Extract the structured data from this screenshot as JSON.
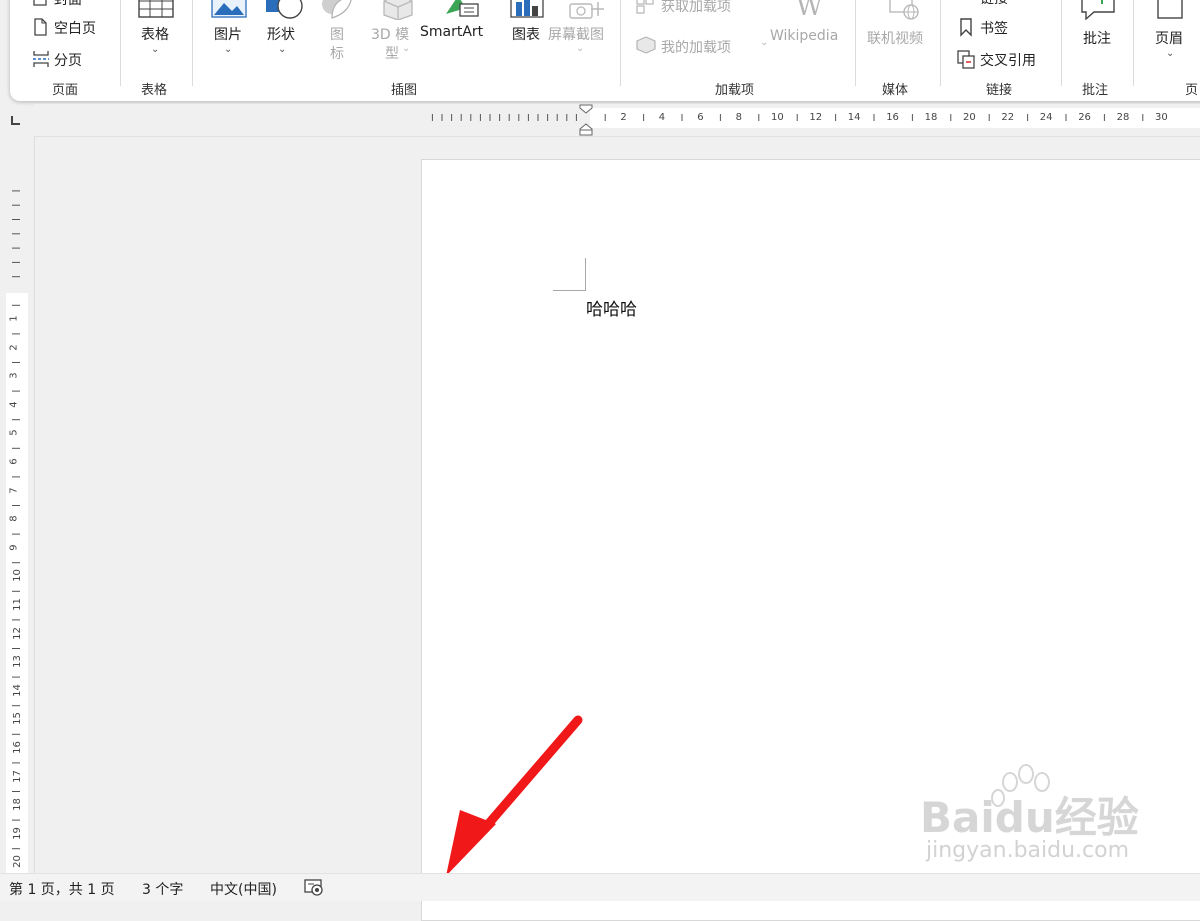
{
  "ribbon": {
    "pages": {
      "items": [
        {
          "label": "封面",
          "icon": "cover-page-icon"
        },
        {
          "label": "空白页",
          "icon": "blank-page-icon"
        },
        {
          "label": "分页",
          "icon": "page-break-icon"
        }
      ],
      "group_label": "页面"
    },
    "tables": {
      "button_label": "表格",
      "icon": "table-icon",
      "group_label": "表格"
    },
    "illustrations": {
      "pictures_label": "图片",
      "shapes_label": "形状",
      "icons_label_1": "图",
      "icons_label_2": "标",
      "model3d_label_1": "3D 模",
      "model3d_label_2": "型",
      "smartart_label": "SmartArt",
      "chart_label": "图表",
      "screenshot_label": "屏幕截图",
      "group_label": "插图"
    },
    "addins": {
      "get_addins_label": "获取加载项",
      "my_addins_label": "我的加载项",
      "wikipedia_label": "Wikipedia",
      "group_label": "加载项"
    },
    "media": {
      "online_video_label": "联机视频",
      "group_label": "媒体"
    },
    "links": {
      "link_label": "链接",
      "bookmark_label": "书签",
      "cross_ref_label": "交叉引用",
      "group_label": "链接"
    },
    "comments": {
      "comment_label": "批注",
      "group_label": "批注"
    },
    "header_footer": {
      "header_label": "页眉",
      "group_label": "页"
    }
  },
  "ruler": {
    "horizontal_numbers": [
      "2",
      "4",
      "6",
      "8",
      "10",
      "12",
      "14",
      "16",
      "18",
      "20",
      "22",
      "24",
      "26",
      "28",
      "30"
    ],
    "vertical_numbers": [
      "1",
      "2",
      "3",
      "4",
      "5",
      "6",
      "7",
      "8",
      "9",
      "10",
      "11",
      "12",
      "13",
      "14",
      "15",
      "16",
      "17",
      "18",
      "19",
      "20"
    ]
  },
  "document": {
    "text": "哈哈哈"
  },
  "status_bar": {
    "page_info": "第 1 页，共 1 页",
    "word_count": "3 个字",
    "language": "中文(中国)",
    "accessibility_icon": "accessibility-check-icon"
  },
  "watermark": {
    "brand": "Baidu经验",
    "url": "jingyan.baidu.com"
  },
  "colors": {
    "arrow": "#f01818",
    "ribbon_bg": "#ffffff",
    "workspace_bg": "#f0f0f0"
  }
}
